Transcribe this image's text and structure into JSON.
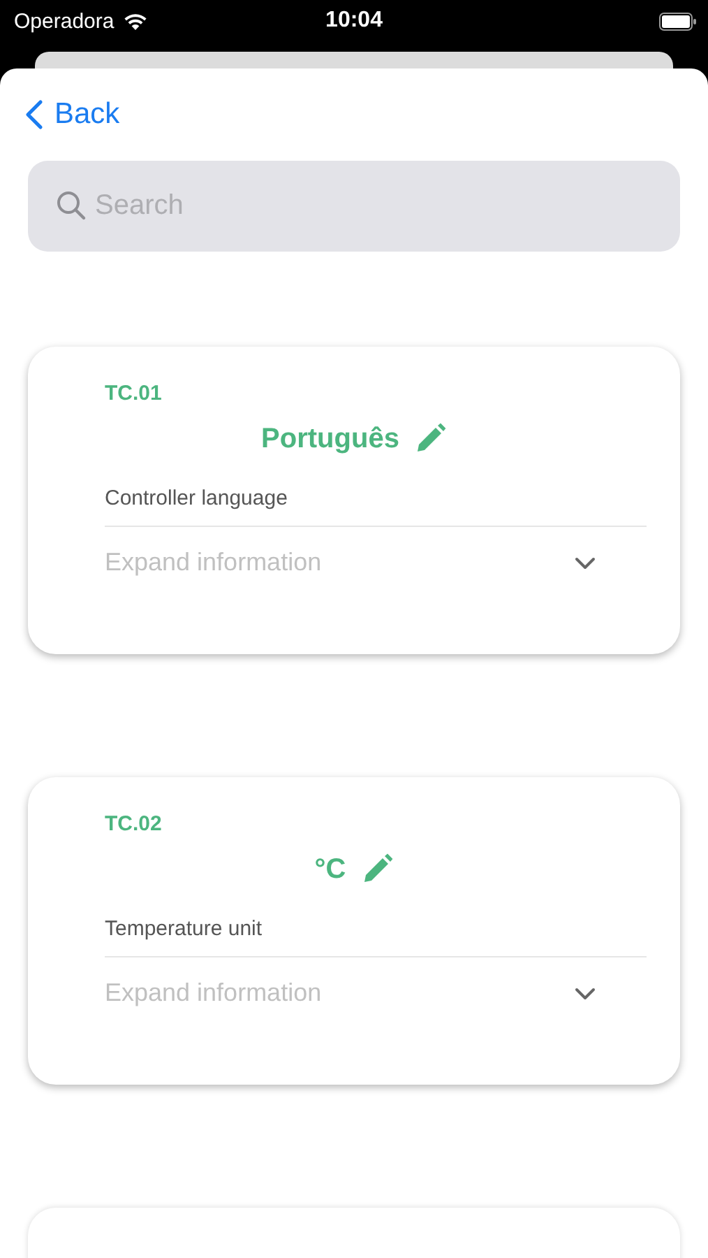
{
  "status_bar": {
    "carrier": "Operadora",
    "time": "10:04"
  },
  "back_button": {
    "label": "Back"
  },
  "search": {
    "placeholder": "Search"
  },
  "cards": [
    {
      "kind": "setting",
      "code": "TC.01",
      "value": "Português",
      "description": "Controller language",
      "expand_label": "Expand information",
      "expanded": false
    },
    {
      "kind": "setting",
      "code": "TC.02",
      "value": "°C",
      "description": "Temperature unit",
      "expand_label": "Expand information",
      "expanded": false
    },
    {
      "kind": "partial"
    }
  ]
}
